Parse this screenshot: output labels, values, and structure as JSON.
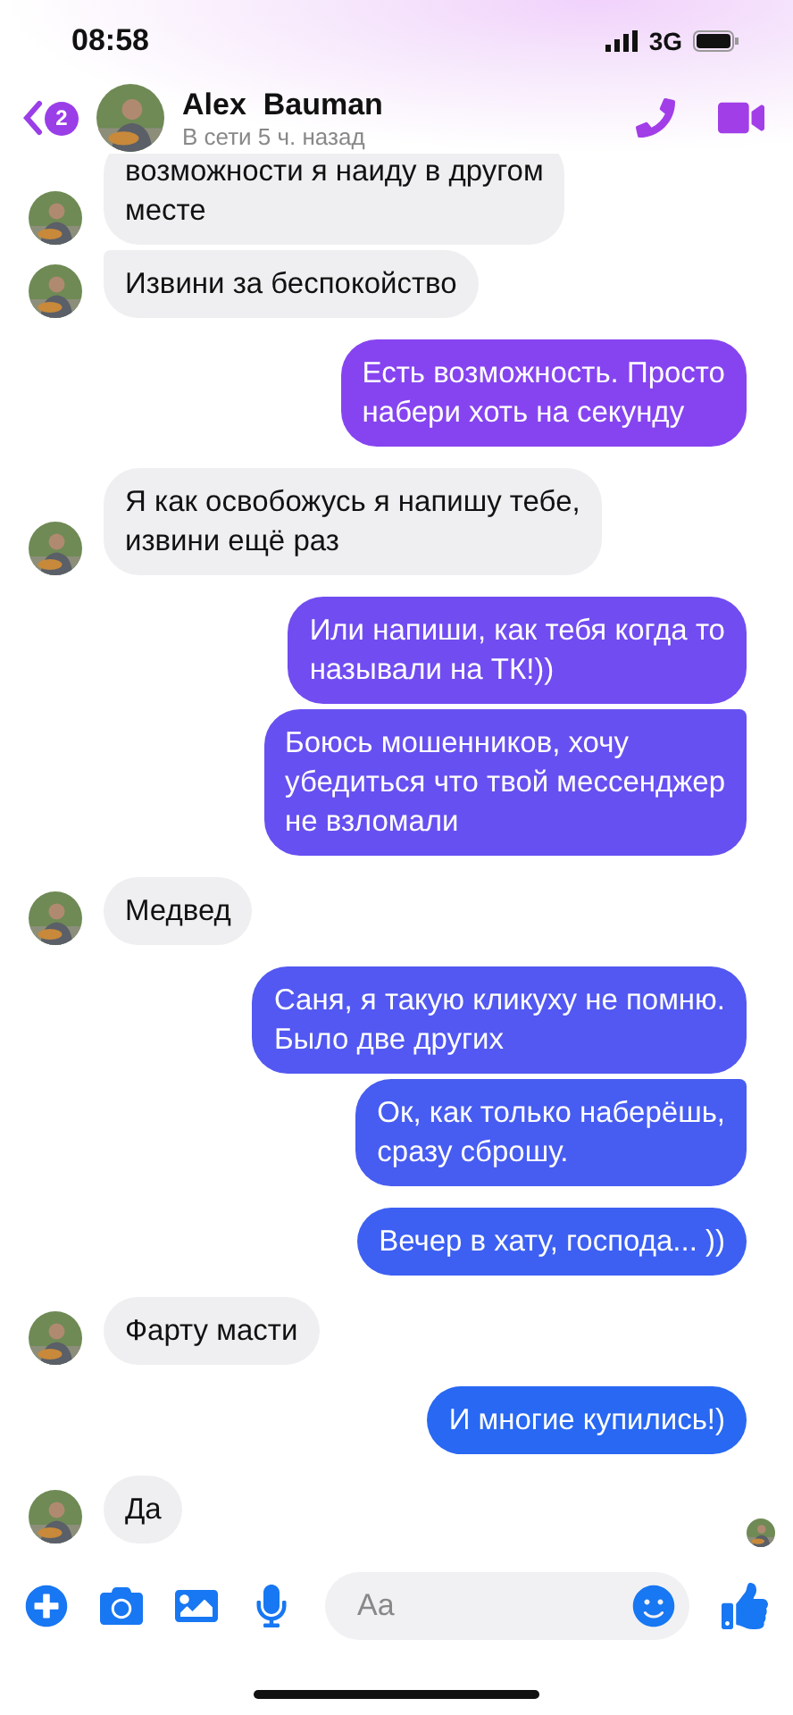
{
  "status_bar": {
    "time": "08:58",
    "network": "3G"
  },
  "header": {
    "back_badge": "2",
    "name": "Alex  Bauman",
    "status": "В сети 5 ч. назад"
  },
  "messages": [
    {
      "kind": "incoming",
      "text": "возможности я наиду в другом\nместе",
      "grouped": false
    },
    {
      "kind": "incoming",
      "text": "Извини за беспокойство",
      "grouped": true
    },
    {
      "kind": "outgoing",
      "text": "Есть возможность. Просто\nнабери хоть на секунду",
      "grouped": false
    },
    {
      "kind": "incoming",
      "text": "Я как освобожусь я напишу тебе,\nизвини ещё раз",
      "grouped": false
    },
    {
      "kind": "outgoing",
      "text": "Или напиши, как тебя когда то\nназывали на ТК!))",
      "grouped": false
    },
    {
      "kind": "outgoing",
      "text": "Боюсь мошенников, хочу\nубедиться что твой мессенджер\nне взломали",
      "grouped": true
    },
    {
      "kind": "incoming",
      "text": "Медвед",
      "grouped": false
    },
    {
      "kind": "outgoing",
      "text": "Саня, я такую кликуху не помню.\nБыло две других",
      "grouped": false
    },
    {
      "kind": "outgoing",
      "text": "Ок, как только наберёшь,\nсразу сброшу.",
      "grouped": true
    },
    {
      "kind": "outgoing",
      "text": "Вечер в хату, господа... ))",
      "grouped": false
    },
    {
      "kind": "incoming",
      "text": "Фарту масти",
      "grouped": false
    },
    {
      "kind": "outgoing",
      "text": "И многие купились!)",
      "grouped": false
    },
    {
      "kind": "incoming",
      "text": "Да",
      "grouped": false
    }
  ],
  "composer": {
    "placeholder": "Aa"
  }
}
